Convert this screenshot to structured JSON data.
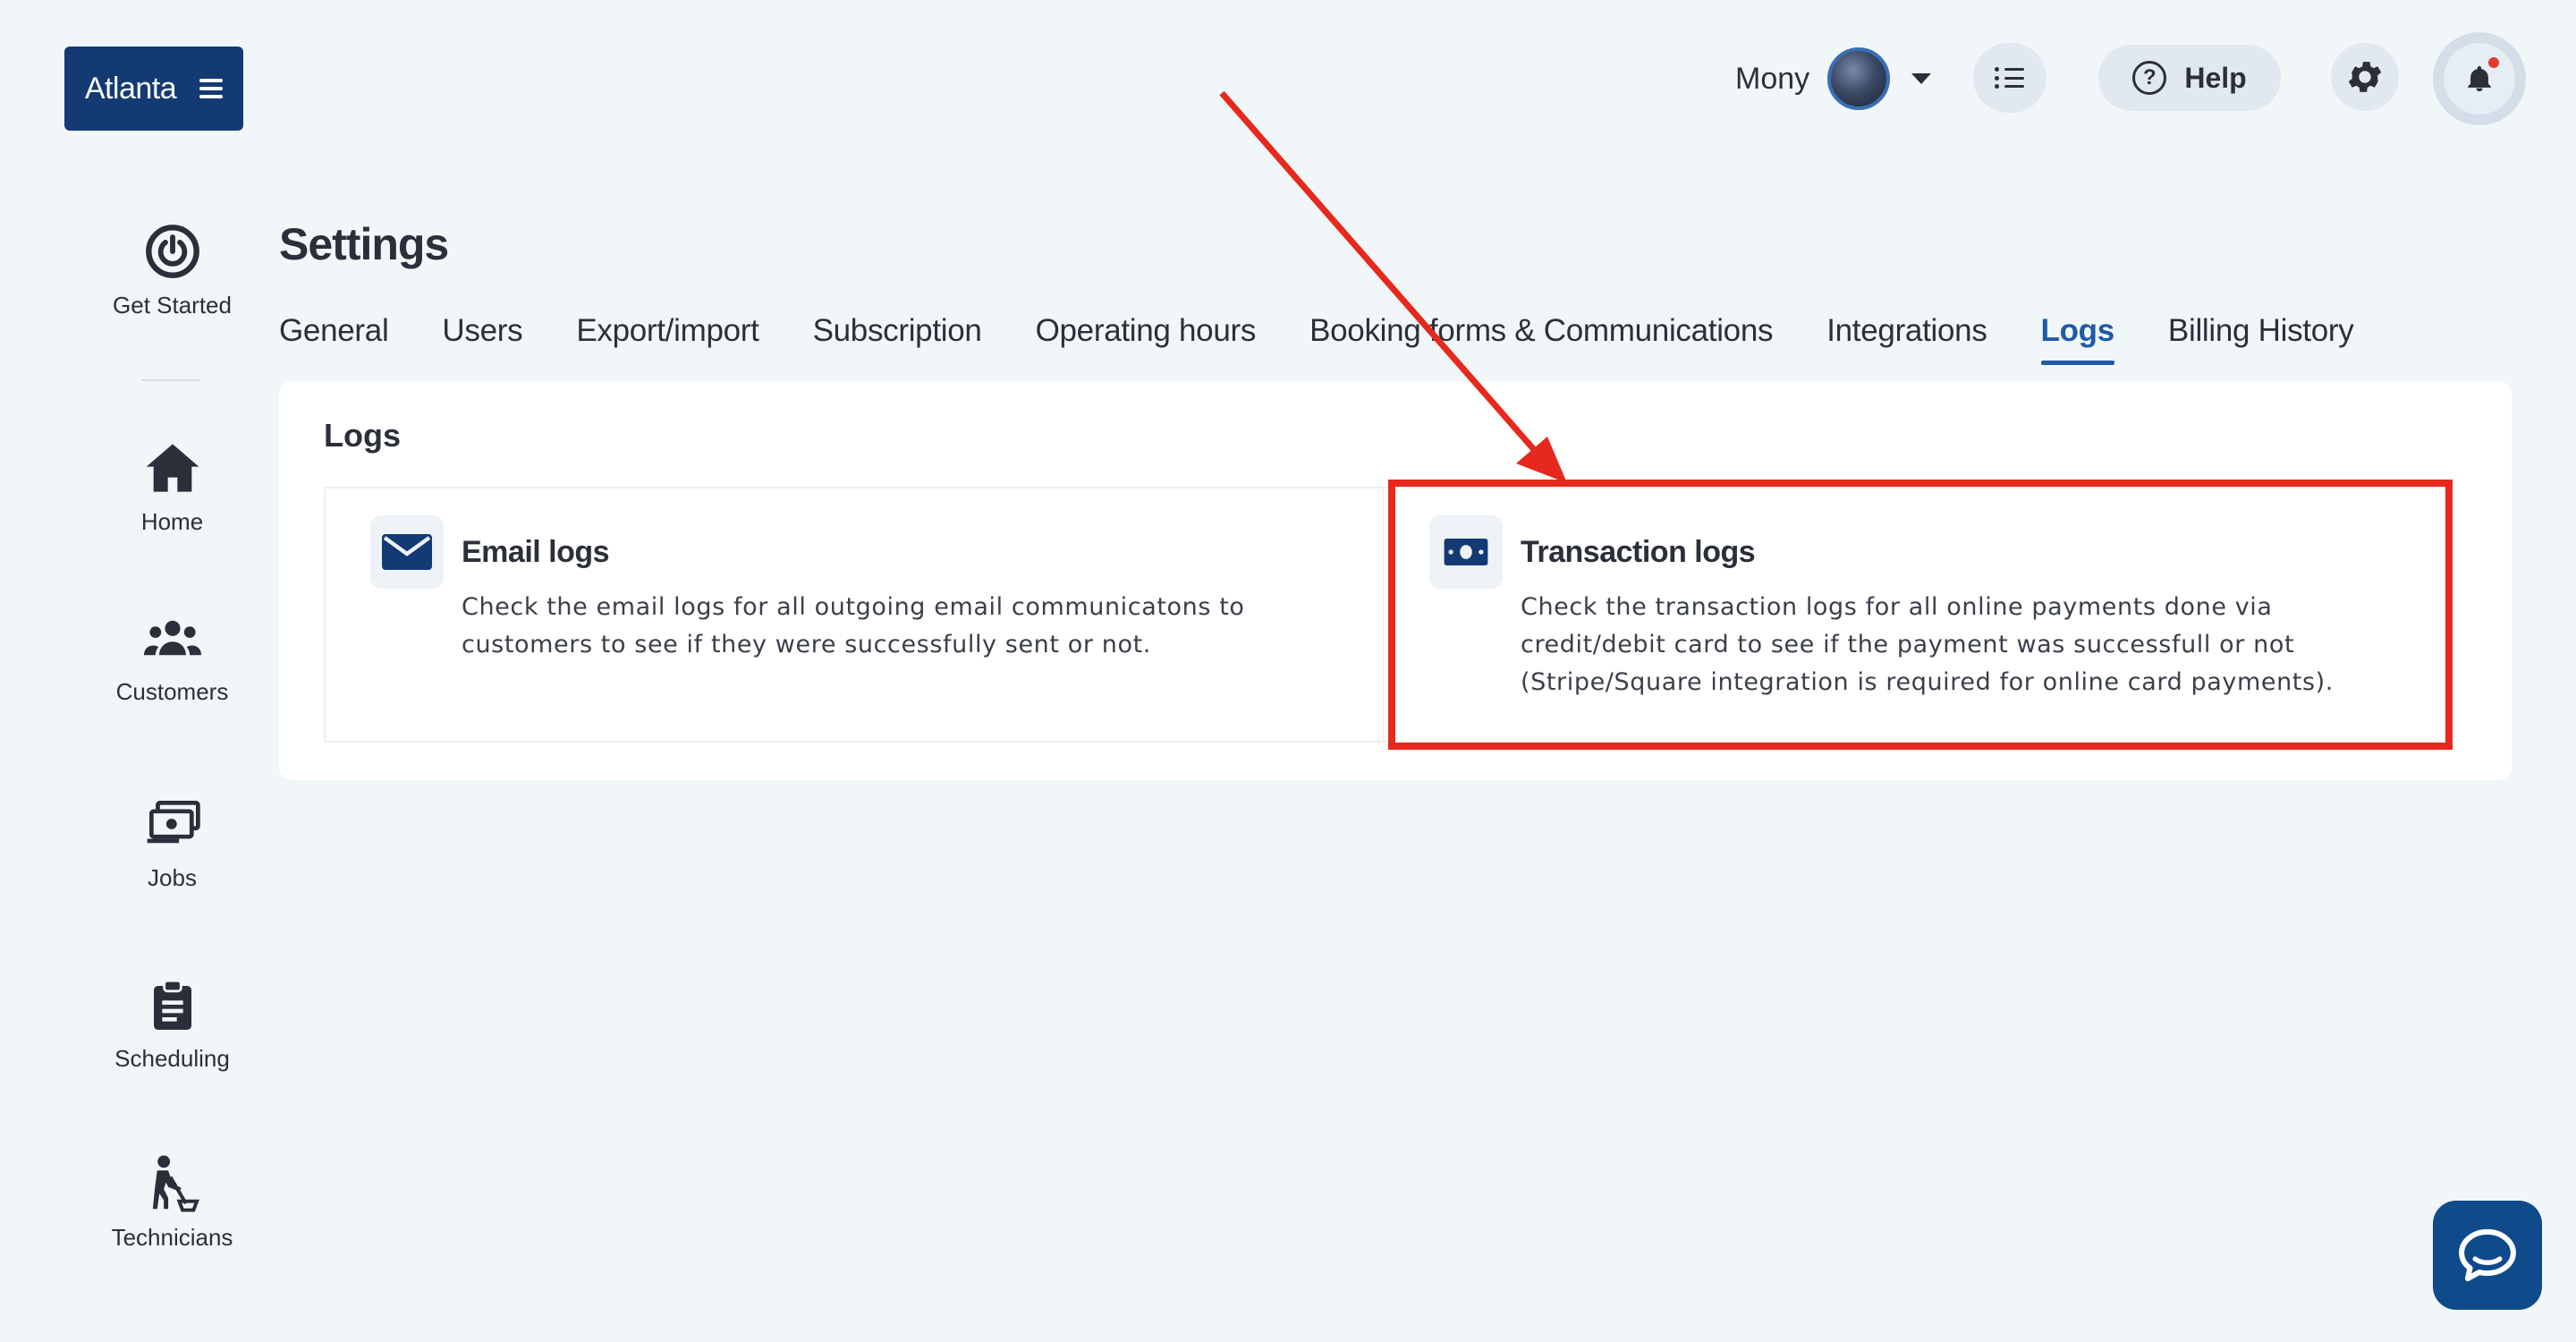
{
  "brand": {
    "label": "Atlanta",
    "menu_icon": "hamburger-icon"
  },
  "header": {
    "user_name": "Mony",
    "help_label": "Help",
    "icons": [
      "caret-down-icon",
      "list-icon",
      "help-circle-icon",
      "gear-icon",
      "bell-icon"
    ]
  },
  "sidebar": {
    "items": [
      {
        "label": "Get Started",
        "icon": "power-icon"
      },
      {
        "label": "Home",
        "icon": "home-icon"
      },
      {
        "label": "Customers",
        "icon": "users-icon"
      },
      {
        "label": "Jobs",
        "icon": "money-stack-icon"
      },
      {
        "label": "Scheduling",
        "icon": "clipboard-icon"
      },
      {
        "label": "Technicians",
        "icon": "technician-icon"
      }
    ]
  },
  "page": {
    "title": "Settings",
    "tabs": [
      {
        "label": "General",
        "active": false
      },
      {
        "label": "Users",
        "active": false
      },
      {
        "label": "Export/import",
        "active": false
      },
      {
        "label": "Subscription",
        "active": false
      },
      {
        "label": "Operating hours",
        "active": false
      },
      {
        "label": "Booking forms & Communications",
        "active": false
      },
      {
        "label": "Integrations",
        "active": false
      },
      {
        "label": "Logs",
        "active": true
      },
      {
        "label": "Billing History",
        "active": false
      }
    ]
  },
  "logs": {
    "title": "Logs",
    "email": {
      "title": "Email logs",
      "description": "Check the email logs for all outgoing email communicatons to customers to see if they were successfully sent or not.",
      "icon": "envelope-icon"
    },
    "transaction": {
      "title": "Transaction logs",
      "description": "Check the transaction logs for all online payments done via credit/debit card to see if the payment was successfull or not (Stripe/Square integration is required for online card payments).",
      "icon": "money-icon"
    }
  },
  "annotation": {
    "color": "#e7281c"
  },
  "colors": {
    "brand": "#133a73",
    "accent": "#1f5aa8",
    "background": "#f1f6f9",
    "chat": "#0f4a8a"
  }
}
